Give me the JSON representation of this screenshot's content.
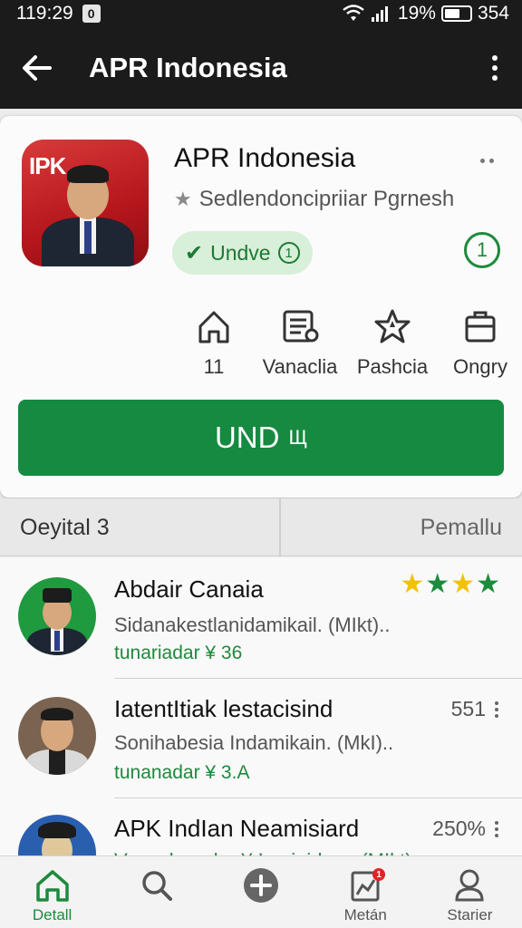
{
  "status_bar": {
    "time": "119:29",
    "sim": "0",
    "battery": "19%",
    "extra": "354"
  },
  "app_bar": {
    "title": "APR Indonesia"
  },
  "app": {
    "logo_text": "IPK",
    "name": "APR Indonesia",
    "subtitle": "Sedlendoncipriiar Pgrnesh",
    "badge_label": "Undve",
    "badge_count": "1",
    "circle_count": "1"
  },
  "stats": [
    {
      "icon": "home-icon",
      "label": "11"
    },
    {
      "icon": "document-icon",
      "label": "Vanaclia"
    },
    {
      "icon": "star-badge-icon",
      "label": "Pashcia"
    },
    {
      "icon": "briefcase-icon",
      "label": "Ongry"
    }
  ],
  "install_button": {
    "label": "UND",
    "sub": "Щ"
  },
  "tabs": {
    "left": "Oeyital 3",
    "right": "Pemallu"
  },
  "list": [
    {
      "name": "Abdair Canaia",
      "desc": "Sidanakestlanidamikail. (MIkt)..",
      "meta": "tunariadar ¥ 36",
      "stars": 4
    },
    {
      "name": "IatentItiak lestacisind",
      "desc": "Sonihabesia Indamikain. (MkI)..",
      "meta": "tunanadar ¥ 3.A",
      "right": "551"
    },
    {
      "name": "APK IndIan Neamisiard",
      "desc": "Vanaclanadar ¥ Imaiaidana (MIkt)..",
      "meta": "",
      "right": "250%"
    }
  ],
  "bottom_nav": [
    {
      "icon": "home-icon",
      "label": "Detall",
      "active": true
    },
    {
      "icon": "search-icon",
      "label": ""
    },
    {
      "icon": "add-icon",
      "label": ""
    },
    {
      "icon": "chart-icon",
      "label": "Metán",
      "badge": "1"
    },
    {
      "icon": "profile-icon",
      "label": "Starier"
    }
  ],
  "colors": {
    "accent": "#158a40",
    "app_bar": "#1b1b1b",
    "star": "#f2c200",
    "star_green": "#1d8a3c"
  }
}
